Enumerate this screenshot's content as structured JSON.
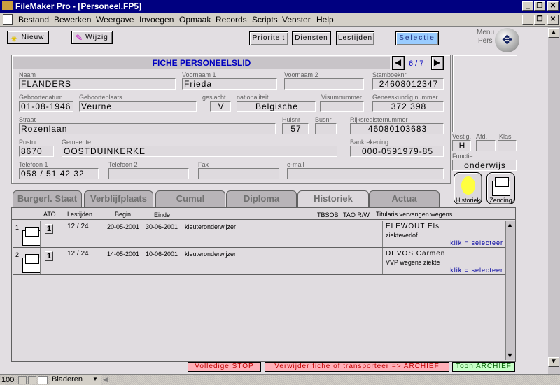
{
  "window": {
    "title": "FileMaker Pro - [Personeel.FP5]"
  },
  "menu": [
    "Bestand",
    "Bewerken",
    "Weergave",
    "Invoegen",
    "Opmaak",
    "Records",
    "Scripts",
    "Venster",
    "Help"
  ],
  "toolbar": {
    "new": "Nieuw",
    "edit": "Wijzig",
    "priority": "Prioriteit",
    "services": "Diensten",
    "lessons": "Lestijden",
    "selection": "Selectie",
    "menu_pers_1": "Menu",
    "menu_pers_2": "Pers"
  },
  "form": {
    "title": "FICHE PERSONEELSLID",
    "record": "6 / 7",
    "fields": {
      "naam": {
        "label": "Naam",
        "value": "FLANDERS"
      },
      "voornaam1": {
        "label": "Voornaam 1",
        "value": "Frieda"
      },
      "voornaam2": {
        "label": "Voornaam 2",
        "value": ""
      },
      "stamboeknr": {
        "label": "Stamboeknr",
        "value": "24608012347"
      },
      "geboortedatum": {
        "label": "Geboortedatum",
        "value": "01-08-1946"
      },
      "geboorteplaats": {
        "label": "Geboorteplaats",
        "value": "Veurne"
      },
      "geslacht": {
        "label": "geslacht",
        "value": "V"
      },
      "nationaliteit": {
        "label": "nationaliteit",
        "value": "Belgische"
      },
      "visumnummer": {
        "label": "Visumnummer",
        "value": ""
      },
      "geneeskundig": {
        "label": "Geneeskundig nummer",
        "value": "372 398"
      },
      "straat": {
        "label": "Straat",
        "value": "Rozenlaan"
      },
      "huisnr": {
        "label": "Huisnr",
        "value": "57"
      },
      "busnr": {
        "label": "Busnr",
        "value": ""
      },
      "rijksreg": {
        "label": "Rijksregisternummer",
        "value": "46080103683"
      },
      "postnr": {
        "label": "Postnr",
        "value": "8670"
      },
      "gemeente": {
        "label": "Gemeente",
        "value": "OOSTDUINKERKE"
      },
      "bank": {
        "label": "Bankrekening",
        "value": "000-0591979-85"
      },
      "tel1": {
        "label": "Telefoon 1",
        "value": "058 / 51 42 32"
      },
      "tel2": {
        "label": "Telefoon 2",
        "value": ""
      },
      "fax": {
        "label": "Fax",
        "value": ""
      },
      "email": {
        "label": "e-mail",
        "value": ""
      },
      "vestig": {
        "label": "Vestig.",
        "value": "H"
      },
      "afd": {
        "label": "Afd.",
        "value": ""
      },
      "klas": {
        "label": "Klas",
        "value": ""
      },
      "functie": {
        "label": "Functie",
        "value": "onderwijs"
      }
    },
    "side_buttons": {
      "history": "Historiek",
      "dispatch": "Zending"
    }
  },
  "tabs": [
    "Burgerl. Staat",
    "Verblijfplaats",
    "Cumul",
    "Diploma",
    "Historiek",
    "Actua"
  ],
  "active_tab": "Historiek",
  "portal": {
    "headers": {
      "ato": "ATO",
      "lestijden": "Lestijden",
      "begin": "Begin",
      "einde": "Einde",
      "tbsob": "TBSOB",
      "tao": "TAO R/W",
      "titularis": "Titularis vervangen wegens ..."
    },
    "rows": [
      {
        "nr": "1",
        "ato": "1",
        "lestijden": "12 / 24",
        "begin": "20-05-2001",
        "einde": "30-06-2001",
        "functie": "kleuteronderwijzer",
        "titularis": "ELEWOUT  Els",
        "reden": "ziekteverlof",
        "link": "klik = selecteer"
      },
      {
        "nr": "2",
        "ato": "1",
        "lestijden": "12 / 24",
        "begin": "14-05-2001",
        "einde": "10-06-2001",
        "functie": "kleuteronderwijzer",
        "titularis": "DEVOS  Carmen",
        "reden": "VVP wegens ziekte",
        "link": "klik = selecteer"
      }
    ]
  },
  "bottom": {
    "stop": "Volledige STOP",
    "delete": "Verwijder fiche of transporteer => ARCHIEF",
    "archive": "Toon ARCHIEF"
  },
  "status": {
    "zoom": "100",
    "mode": "Bladeren"
  },
  "colors": {
    "title_bar": "#000080",
    "selection": "#99ccff",
    "stop": "#ffb0b8",
    "archive": "#c8ffc8",
    "link": "#0000a0"
  }
}
